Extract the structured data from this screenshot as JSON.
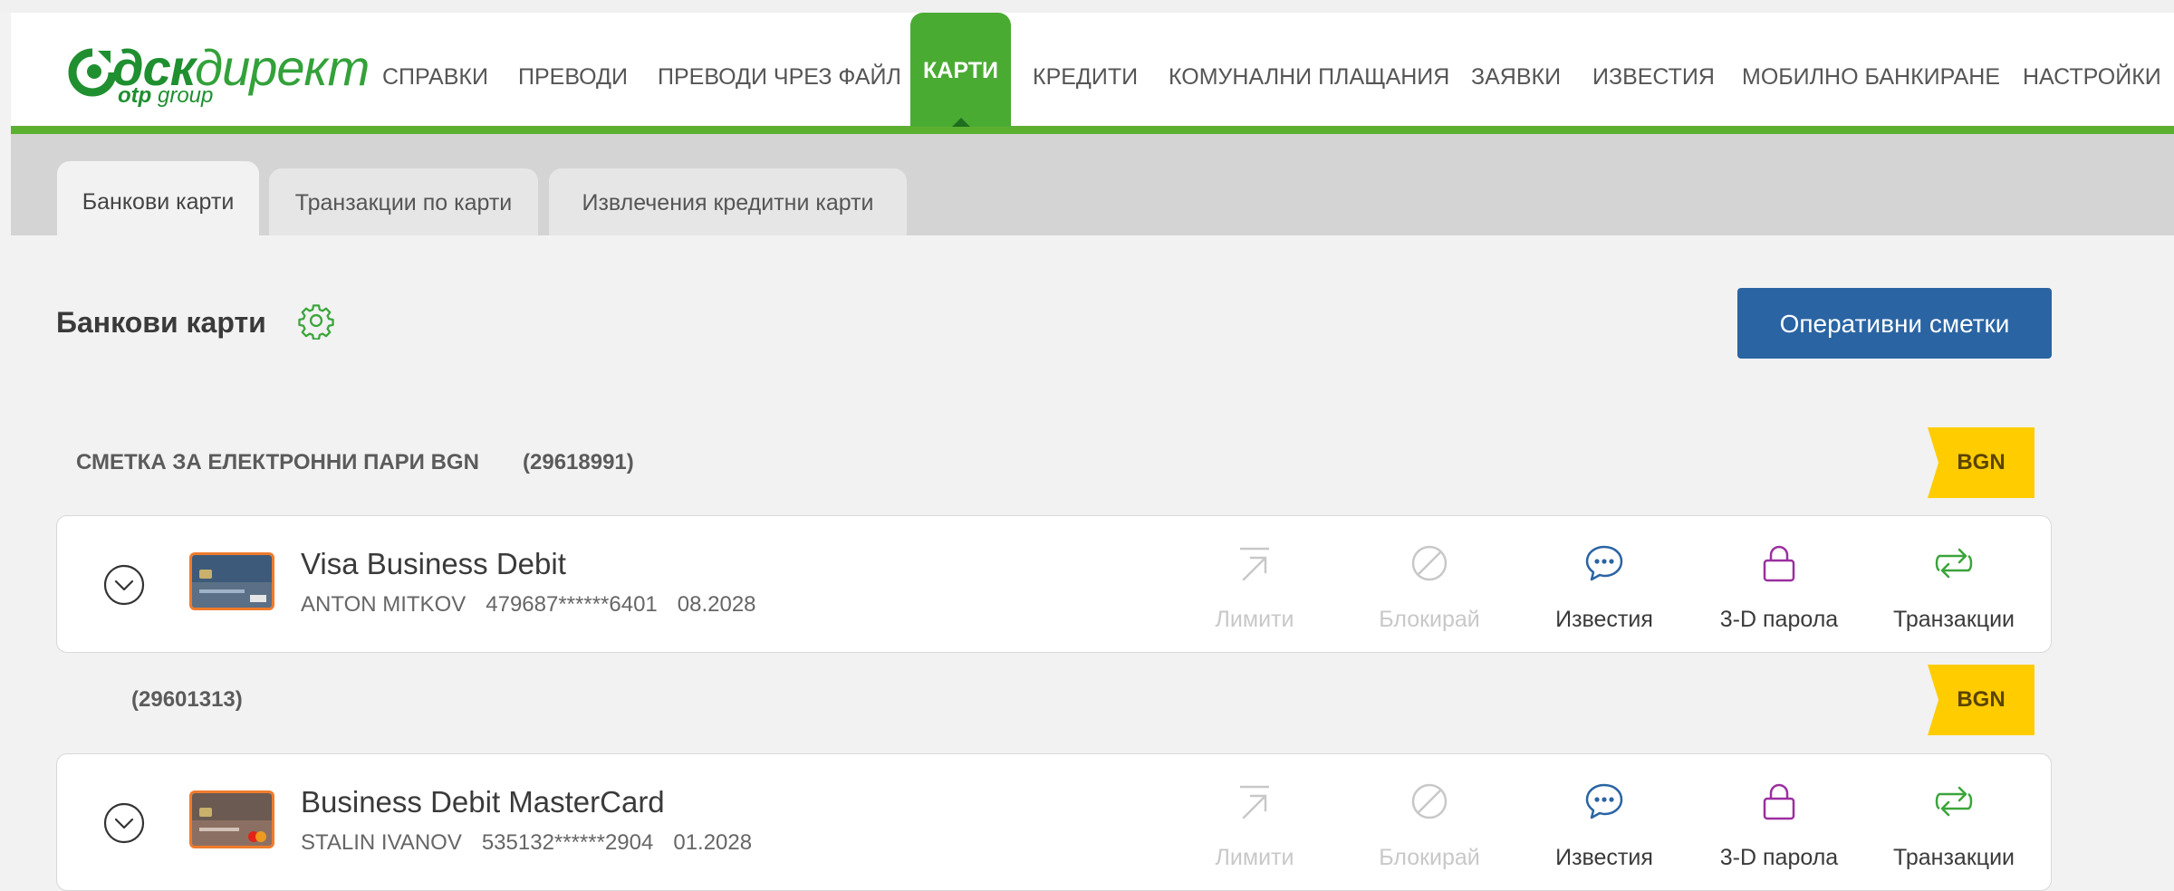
{
  "logo": {
    "main_bold": "дск",
    "main_light": "директ",
    "sub_bold": "otp",
    "sub_light": "group"
  },
  "nav": {
    "items": [
      {
        "label": "СПРАВКИ"
      },
      {
        "label": "ПРЕВОДИ"
      },
      {
        "label": "ПРЕВОДИ ЧРЕЗ ФАЙЛ"
      },
      {
        "label": "КАРТИ",
        "active": true
      },
      {
        "label": "КРЕДИТИ"
      },
      {
        "label": "КОМУНАЛНИ ПЛАЩАНИЯ"
      },
      {
        "label": "ЗАЯВКИ"
      },
      {
        "label": "ИЗВЕСТИЯ"
      },
      {
        "label": "МОБИЛНО БАНКИРАНЕ"
      },
      {
        "label": "НАСТРОЙКИ"
      }
    ]
  },
  "tabs": [
    {
      "label": "Банкови карти",
      "active": true
    },
    {
      "label": "Транзакции по карти"
    },
    {
      "label": "Извлечения кредитни карти"
    }
  ],
  "page": {
    "title": "Банкови карти",
    "operative_accounts_button": "Оперативни сметки"
  },
  "accounts": [
    {
      "name": "СМЕТКА ЗА ЕЛЕКТРОННИ ПАРИ BGN",
      "number": "(29618991)",
      "currency": "BGN",
      "card": {
        "name": "Visa Business Debit",
        "holder": "ANTON MITKOV",
        "number": "479687******6401",
        "expiry": "08.2028"
      }
    },
    {
      "name": "",
      "number": "(29601313)",
      "currency": "BGN",
      "card": {
        "name": "Business Debit MasterCard",
        "holder": "STALIN IVANOV",
        "number": "535132******2904",
        "expiry": "01.2028"
      }
    }
  ],
  "actions": {
    "limits": "Лимити",
    "block": "Блокирай",
    "notifications": "Известия",
    "password_3d": "3-D парола",
    "transactions": "Транзакции"
  },
  "colors": {
    "brand_green": "#4aab33",
    "button_blue": "#2a64a3",
    "badge_yellow": "#ffcc00",
    "card_orange": "#ef7b2b",
    "icon_blue": "#2a64a3",
    "icon_purple": "#9b2fa0",
    "icon_green": "#3aa53a"
  },
  "icons": {
    "settings": "gear-icon",
    "expand": "chevron-down-circle-icon",
    "limits": "arrow-up-right-icon",
    "block": "block-icon",
    "notifications": "chat-bubble-icon",
    "password_3d": "lock-icon",
    "transactions": "swap-arrows-icon"
  }
}
